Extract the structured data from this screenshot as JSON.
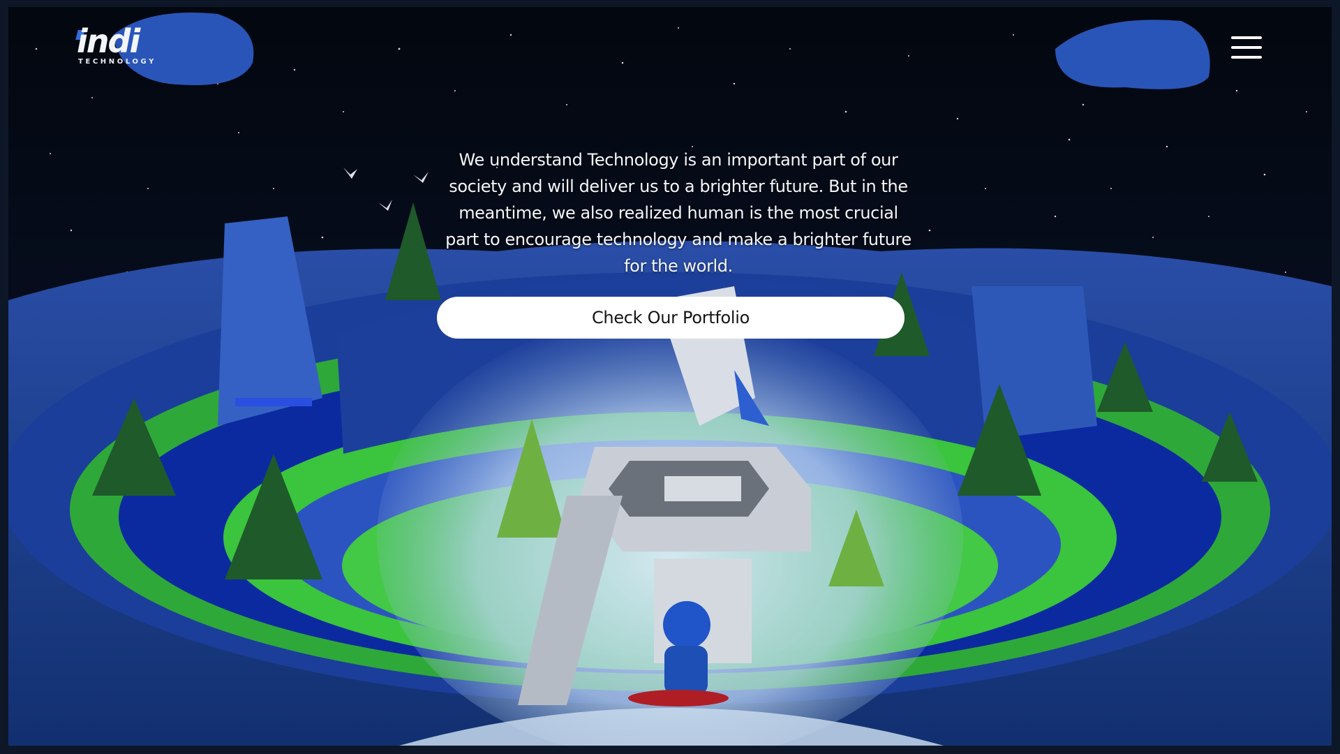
{
  "brand": {
    "name": "indi",
    "tagline": "TECHNOLOGY",
    "accent_color": "#2f6fe0"
  },
  "header": {
    "menu_icon": "hamburger-menu-icon"
  },
  "hero": {
    "text": "We understand Technology is an important part of our society and will deliver us to a brighter future. But in the meantime, we also realized human is the most crucial part to encourage technology and make a brighter future for the world.",
    "cta_label": "Check Our Portfolio"
  },
  "scene": {
    "description_icon": "3d-island-scene",
    "colors": {
      "sky": "#050a14",
      "terrain": "#1e3f9c",
      "grass": "#3fbf3f",
      "water": "#0a2a9a",
      "spotlight": "#cfe3f5"
    }
  }
}
